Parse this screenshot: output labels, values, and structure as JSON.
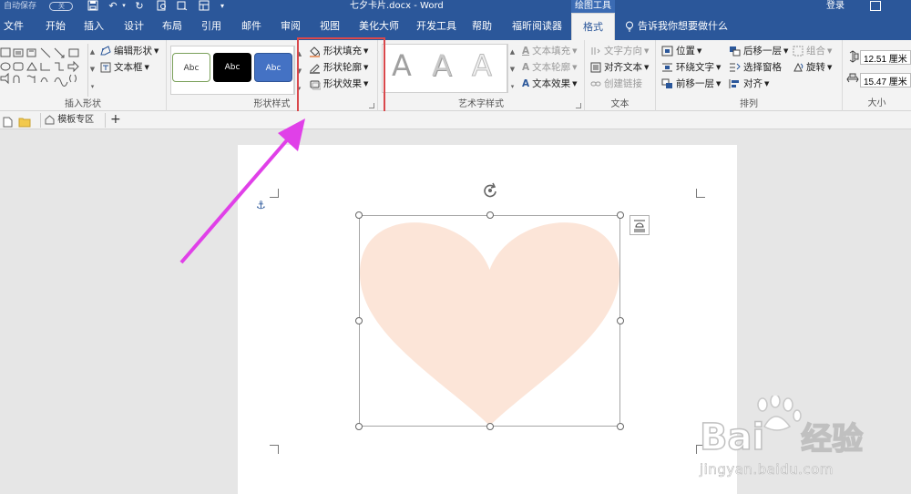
{
  "titlebar": {
    "autosave_label": "自动保存",
    "autosave_state": "关",
    "doc_title": "七夕卡片.docx  -  Word",
    "context_title": "绘图工具",
    "login": "登录"
  },
  "tabs": [
    "文件",
    "开始",
    "插入",
    "设计",
    "布局",
    "引用",
    "邮件",
    "审阅",
    "视图",
    "美化大师",
    "开发工具",
    "帮助",
    "福昕阅读器",
    "格式"
  ],
  "active_tab": "格式",
  "tell_me": "告诉我你想要做什么",
  "ribbon": {
    "insert_shapes": {
      "label": "插入形状",
      "edit_shape": "编辑形状",
      "text_box": "文本框"
    },
    "shape_styles": {
      "label": "形状样式",
      "swatch_text": "Abc",
      "fill": "形状填充",
      "outline": "形状轮廓",
      "effects": "形状效果"
    },
    "wordart": {
      "label": "艺术字样式",
      "letter": "A",
      "text_fill": "文本填充",
      "text_outline": "文本轮廓",
      "text_effects": "文本效果"
    },
    "text": {
      "label": "文本",
      "direction": "文字方向",
      "align_text": "对齐文本",
      "create_link": "创建链接"
    },
    "arrange": {
      "label": "排列",
      "position": "位置",
      "wrap_text": "环绕文字",
      "bring_forward": "前移一层",
      "send_backward": "后移一层",
      "selection_pane": "选择窗格",
      "align": "对齐",
      "group": "组合",
      "rotate": "旋转"
    },
    "size": {
      "label": "大小",
      "height": "12.51 厘米",
      "width": "15.47 厘米"
    }
  },
  "doc_tabs": {
    "template_zone": "模板专区",
    "add": "+"
  },
  "shape": {
    "kind": "heart",
    "fill_color": "#fce5d8"
  },
  "watermark": {
    "brand": "Bai",
    "brand_cn": "经验",
    "url": "jingyan.baidu.com"
  },
  "colors": {
    "accent": "#2b579a",
    "highlight": "#d9484c",
    "arrow": "#e040e8"
  }
}
